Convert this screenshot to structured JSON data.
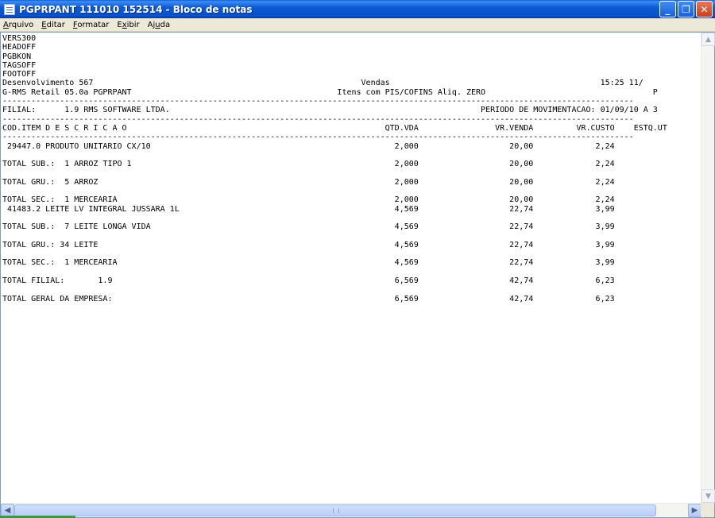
{
  "window": {
    "title": "PGPRPANT 111010 152514 - Bloco de notas",
    "minimize": "_",
    "maximize": "❐",
    "close": "✕"
  },
  "menu": {
    "items": [
      {
        "pre": "",
        "u": "A",
        "post": "rquivo"
      },
      {
        "pre": "",
        "u": "E",
        "post": "ditar"
      },
      {
        "pre": "",
        "u": "F",
        "post": "ormatar"
      },
      {
        "pre": "E",
        "u": "x",
        "post": "ibir"
      },
      {
        "pre": "Aj",
        "u": "u",
        "post": "da"
      }
    ]
  },
  "document": {
    "lines": [
      "VERS300",
      "HEADOFF",
      "PGBKON",
      "TAGSOFF",
      "FOOTOFF",
      "Desenvolvimento 567                                                        Vendas                                            15:25 11/",
      "G-RMS Retail 05.0a PGPRPANT                                           Itens com PIS/COFINS Aliq. ZERO                                   P",
      "------------------------------------------------------------------------------------------------------------------------------------",
      "FILIAL:      1.9 RMS SOFTWARE LTDA.                                                                 PERIODO DE MOVIMENTACAO: 01/09/10 A 3",
      "------------------------------------------------------------------------------------------------------------------------------------",
      "COD.ITEM D E S C R I C A O                                                      QTD.VDA                VR.VENDA         VR.CUSTO    ESTQ.UT",
      "------------------------------------------------------------------------------------------------------------------------------------",
      " 29447.0 PRODUTO UNITARIO CX/10                                                   2,000                   20,00             2,24",
      "",
      "TOTAL SUB.:  1 ARROZ TIPO 1                                                       2,000                   20,00             2,24",
      "",
      "TOTAL GRU.:  5 ARROZ                                                              2,000                   20,00             2,24",
      "",
      "TOTAL SEC.:  1 MERCEARIA                                                          2,000                   20,00             2,24",
      " 41483.2 LEITE LV INTEGRAL JUSSARA 1L                                             4,569                   22,74             3,99",
      "",
      "TOTAL SUB.:  7 LEITE LONGA VIDA                                                   4,569                   22,74             3,99",
      "",
      "TOTAL GRU.: 34 LEITE                                                              4,569                   22,74             3,99",
      "",
      "TOTAL SEC.:  1 MERCEARIA                                                          4,569                   22,74             3,99",
      "",
      "TOTAL FILIAL:       1.9                                                           6,569                   42,74             6,23",
      "",
      "TOTAL GERAL DA EMPRESA:                                                           6,569                   42,74             6,23"
    ]
  },
  "scrollbar": {
    "up": "▲",
    "down": "▼",
    "left": "◀",
    "right": "▶"
  },
  "colors": {
    "title_bar": "#0a50c8",
    "editor_bg": "#ffffff",
    "chrome": "#ece9d8"
  }
}
